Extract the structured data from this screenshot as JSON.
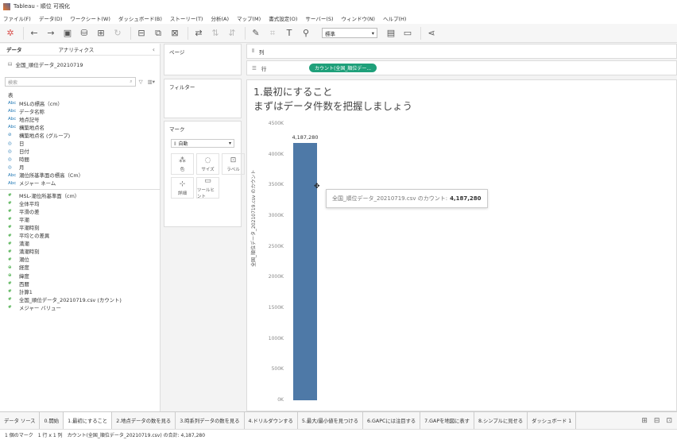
{
  "window": {
    "title": "Tableau - 順位 可視化"
  },
  "menu": [
    "ファイル(F)",
    "データ(D)",
    "ワークシート(W)",
    "ダッシュボード(B)",
    "ストーリー(T)",
    "分析(A)",
    "マップ(M)",
    "書式設定(O)",
    "サーバー(S)",
    "ウィンドウ(N)",
    "ヘルプ(H)"
  ],
  "toolbar": {
    "fit_select": "標準"
  },
  "left_pane": {
    "tabs": [
      "データ",
      "アナリティクス"
    ],
    "data_source": "全国_順位データ_20210719",
    "search_placeholder": "検索",
    "table_header": "表",
    "dimensions": [
      {
        "type": "Abc",
        "name": "MSLの標高（cm）"
      },
      {
        "type": "Abc",
        "name": "データ名称"
      },
      {
        "type": "Abc",
        "name": "地点記号"
      },
      {
        "type": "Abc",
        "name": "構築地点名"
      },
      {
        "type": "⊘",
        "name": "構築地点名 (グループ)"
      },
      {
        "type": "◎",
        "name": "日"
      },
      {
        "type": "◎",
        "name": "日付"
      },
      {
        "type": "◎",
        "name": "時間"
      },
      {
        "type": "◎",
        "name": "月"
      },
      {
        "type": "Abc",
        "name": "潮位所基準面の標高（Cm）"
      },
      {
        "type": "Abc",
        "name": "メジャー ネーム"
      }
    ],
    "measures": [
      {
        "type": "#",
        "name": "MSL-潮位所基準面（cm）"
      },
      {
        "type": "#",
        "name": "全体平均"
      },
      {
        "type": "#",
        "name": "平滑の差"
      },
      {
        "type": "#",
        "name": "平潮"
      },
      {
        "type": "#",
        "name": "平潮時刻"
      },
      {
        "type": "#",
        "name": "平均との差異"
      },
      {
        "type": "#",
        "name": "満潮"
      },
      {
        "type": "#",
        "name": "満潮時刻"
      },
      {
        "type": "#",
        "name": "潮位"
      },
      {
        "type": "⊕",
        "name": "経度"
      },
      {
        "type": "⊕",
        "name": "緯度"
      },
      {
        "type": "#",
        "name": "西暦"
      },
      {
        "type": "#",
        "name": "計算1"
      },
      {
        "type": "#",
        "name": "全国_順位データ_20210719.csv (カウント)"
      },
      {
        "type": "#",
        "name": "メジャー バリュー"
      }
    ]
  },
  "cards": {
    "pages": "ページ",
    "filters": "フィルター",
    "marks": "マーク",
    "marks_type": "自動",
    "mark_buttons": [
      {
        "icon": "⁂",
        "label": "色"
      },
      {
        "icon": "◌",
        "label": "サイズ"
      },
      {
        "icon": "⊡",
        "label": "ラベル"
      },
      {
        "icon": "⊹",
        "label": "詳細"
      },
      {
        "icon": "▭",
        "label": "ツールヒント"
      }
    ]
  },
  "shelves": {
    "columns_label": "列",
    "rows_label": "行",
    "rows_pill": "カウント(全国_順位デー..."
  },
  "viz": {
    "title_line1": "1.最初にすること",
    "title_line2": "まずはデータ件数を把握しましょう",
    "tooltip_label": "全国_順位データ_20210719.csv のカウント:",
    "tooltip_value": "4,187,280"
  },
  "chart_data": {
    "type": "bar",
    "categories": [
      ""
    ],
    "values": [
      4187280
    ],
    "data_labels": [
      "4,187,280"
    ],
    "ylabel": "全国_順位データ_20210719.csv のカウント",
    "ylim": [
      0,
      4500000
    ],
    "yticks": [
      0,
      500000,
      1000000,
      1500000,
      2000000,
      2500000,
      3000000,
      3500000,
      4000000,
      4500000
    ],
    "ytick_labels": [
      "0K",
      "500K",
      "1000K",
      "1500K",
      "2000K",
      "2500K",
      "3000K",
      "3500K",
      "4000K",
      "4500K"
    ],
    "color": "#4e79a7"
  },
  "sheet_tabs": [
    "データ ソース",
    "0.開始",
    "1.最初にすること",
    "2.地点データの数を見る",
    "3.時系列データの数を見る",
    "4.ドリルダウンする",
    "5.最大/最小値を見つける",
    "6.GAPCには注目する",
    "7.GAPを地図に表す",
    "8.シンプルに見せる",
    "ダッシュボード 1"
  ],
  "active_tab_index": 2,
  "status": {
    "marks": "1 個のマーク",
    "rows_cols": "1 行 x 1 列",
    "sum": "カウント(全国_順位データ_20210719.csv) の合計: 4,187,280"
  }
}
